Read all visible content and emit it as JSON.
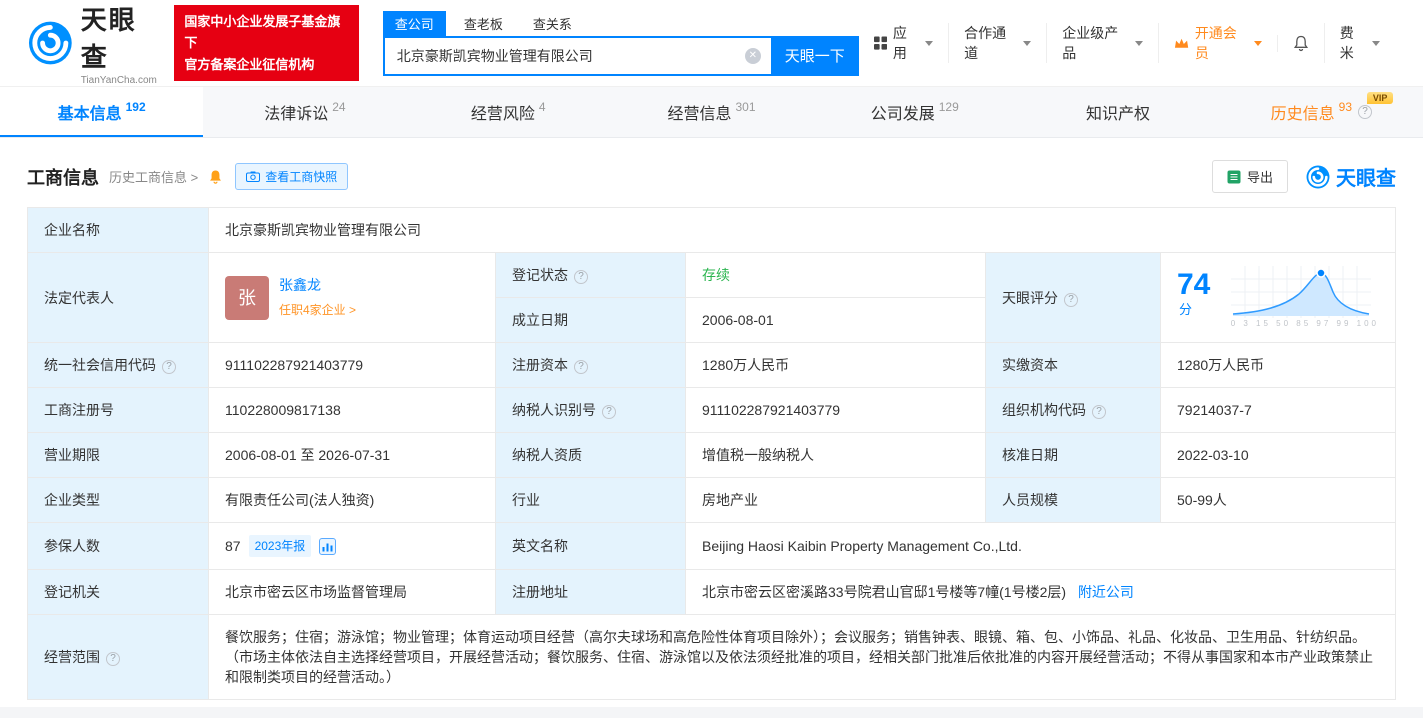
{
  "colors": {
    "accent": "#0084ff",
    "badge_red": "#e60012",
    "status_green": "#2cb550",
    "vip_orange": "#ff8a1e",
    "label_bg": "#e4f3fd"
  },
  "header": {
    "logo": {
      "title": "天眼查",
      "subtitle": "TianYanCha.com"
    },
    "badge": {
      "line1": "国家中小企业发展子基金旗下",
      "line2": "官方备案企业征信机构"
    },
    "search": {
      "tabs": [
        {
          "label": "查公司"
        },
        {
          "label": "查老板"
        },
        {
          "label": "查关系"
        }
      ],
      "value": "北京豪斯凯宾物业管理有限公司",
      "button": "天眼一下"
    },
    "nav": {
      "apps": "应用",
      "partner": "合作通道",
      "enterprise": "企业级产品",
      "vip": "开通会员",
      "user": "费米"
    }
  },
  "tabbar": [
    {
      "label": "基本信息",
      "count": "192"
    },
    {
      "label": "法律诉讼",
      "count": "24"
    },
    {
      "label": "经营风险",
      "count": "4"
    },
    {
      "label": "经营信息",
      "count": "301"
    },
    {
      "label": "公司发展",
      "count": "129"
    },
    {
      "label": "知识产权",
      "count": ""
    },
    {
      "label": "历史信息",
      "count": "93"
    }
  ],
  "vip_badge": "VIP",
  "section": {
    "title": "工商信息",
    "history_link": "历史工商信息 >",
    "snapshot_button": "查看工商快照",
    "export_button": "导出",
    "brand": "天眼查"
  },
  "fields": {
    "company_name": {
      "label": "企业名称",
      "value": "北京豪斯凯宾物业管理有限公司"
    },
    "legal_rep": {
      "label": "法定代表人",
      "avatar": "张",
      "name": "张鑫龙",
      "jobs": "任职4家企业 >"
    },
    "reg_status": {
      "label": "登记状态",
      "value": "存续"
    },
    "establish_date": {
      "label": "成立日期",
      "value": "2006-08-01"
    },
    "score": {
      "label": "天眼评分",
      "value": "74",
      "unit": "分",
      "axis_ticks": "0 3 15 50 85 97 99 100"
    },
    "credit_code": {
      "label": "统一社会信用代码",
      "value": "911102287921403779"
    },
    "reg_capital": {
      "label": "注册资本",
      "value": "1280万人民币"
    },
    "paid_capital": {
      "label": "实缴资本",
      "value": "1280万人民币"
    },
    "reg_no": {
      "label": "工商注册号",
      "value": "110228009817138"
    },
    "taxpayer_no": {
      "label": "纳税人识别号",
      "value": "911102287921403779"
    },
    "org_code": {
      "label": "组织机构代码",
      "value": "79214037-7"
    },
    "business_term": {
      "label": "营业期限",
      "value": "2006-08-01 至 2026-07-31"
    },
    "taxpayer_quality": {
      "label": "纳税人资质",
      "value": "增值税一般纳税人"
    },
    "approve_date": {
      "label": "核准日期",
      "value": "2022-03-10"
    },
    "company_type": {
      "label": "企业类型",
      "value": "有限责任公司(法人独资)"
    },
    "industry": {
      "label": "行业",
      "value": "房地产业"
    },
    "staff_size": {
      "label": "人员规模",
      "value": "50-99人"
    },
    "insured": {
      "label": "参保人数",
      "value": "87",
      "report": "2023年报"
    },
    "english_name": {
      "label": "英文名称",
      "value": "Beijing Haosi Kaibin Property Management Co.,Ltd."
    },
    "reg_authority": {
      "label": "登记机关",
      "value": "北京市密云区市场监督管理局"
    },
    "address": {
      "label": "注册地址",
      "value": "北京市密云区密溪路33号院君山官邸1号楼等7幢(1号楼2层)",
      "nearby": "附近公司"
    },
    "scope": {
      "label": "经营范围",
      "value": "餐饮服务；住宿；游泳馆；物业管理；体育运动项目经营（高尔夫球场和高危险性体育项目除外）；会议服务；销售钟表、眼镜、箱、包、小饰品、礼品、化妆品、卫生用品、针纺织品。（市场主体依法自主选择经营项目，开展经营活动；餐饮服务、住宿、游泳馆以及依法须经批准的项目，经相关部门批准后依批准的内容开展经营活动；不得从事国家和本市产业政策禁止和限制类项目的经营活动。）"
    }
  }
}
